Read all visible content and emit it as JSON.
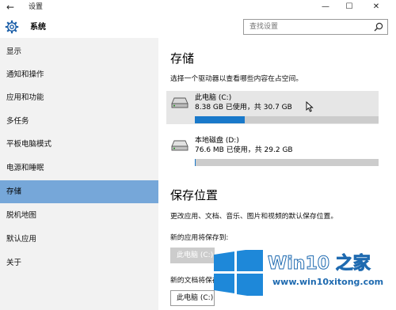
{
  "window": {
    "back_glyph": "←",
    "title": "设置",
    "min_glyph": "—",
    "max_glyph": "☐",
    "close_glyph": "✕"
  },
  "header": {
    "app_title": "系统",
    "gear_icon": "gear-icon",
    "search_placeholder": "查找设置",
    "search_icon": "search-icon"
  },
  "sidebar": {
    "items": [
      {
        "label": "显示",
        "active": false
      },
      {
        "label": "通知和操作",
        "active": false
      },
      {
        "label": "应用和功能",
        "active": false
      },
      {
        "label": "多任务",
        "active": false
      },
      {
        "label": "平板电脑模式",
        "active": false
      },
      {
        "label": "电源和睡眠",
        "active": false
      },
      {
        "label": "存储",
        "active": true
      },
      {
        "label": "脱机地图",
        "active": false
      },
      {
        "label": "默认应用",
        "active": false
      },
      {
        "label": "关于",
        "active": false
      }
    ]
  },
  "main": {
    "storage_heading": "存储",
    "storage_desc": "选择一个驱动器以查看哪些内容在占空间。",
    "drives": [
      {
        "name": "此电脑 (C:)",
        "usage": "8.38 GB 已使用，共 30.7 GB",
        "used_fraction": 0.273,
        "selected": true
      },
      {
        "name": "本地磁盘 (D:)",
        "usage": "76.6 MB 已使用，共 29.2 GB",
        "used_fraction": 0.003,
        "selected": false
      }
    ],
    "save_heading": "保存位置",
    "save_desc": "更改应用、文档、音乐、图片和视频的默认保存位置。",
    "new_apps_label": "新的应用将保存到:",
    "new_apps_value": "此电脑 (C:)",
    "new_docs_label": "新的文档将保存到:",
    "new_docs_value": "此电脑 (C:)"
  },
  "watermark": {
    "brand": "Win10 之家",
    "url": "www.win10xitong.com"
  },
  "colors": {
    "accent": "#1979ca",
    "nav_active": "#76a7d9",
    "sidebar_bg": "#f2f2f2",
    "bar_bg": "#cccccc"
  }
}
